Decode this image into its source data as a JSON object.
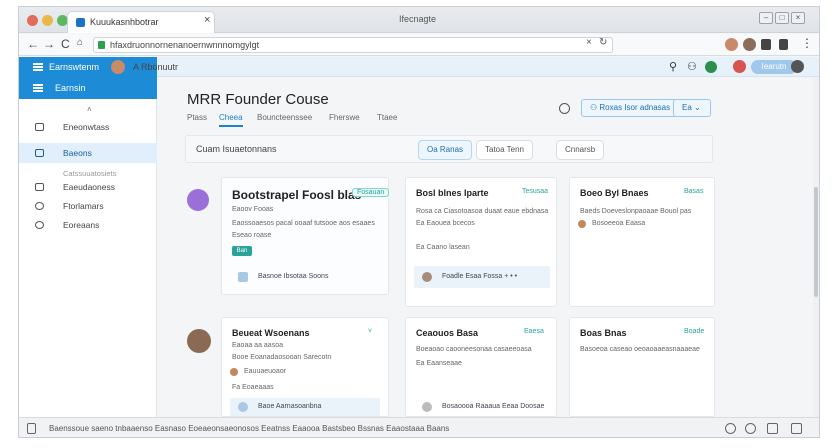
{
  "browser": {
    "tab_title": "Kuuukasnhbotrar",
    "window_title": "Ifecnagte",
    "url": "hfaxdruonnornenanoernwnnnomgylgt",
    "tab_close": "×"
  },
  "appbar": {
    "brand": "Earnswtenm",
    "user_name": "A  Rbonuutr",
    "pill_label": "Iearutn"
  },
  "sidebar": {
    "header": "Earnsin",
    "arrow": "˄",
    "items": [
      {
        "label": "Eneonwtass"
      },
      {
        "label": "Baeons"
      },
      {
        "label": "Eaeudaoness"
      },
      {
        "label": "Ftorlamars"
      },
      {
        "label": "Eoreaans"
      }
    ],
    "section_label": "Catssuuatosiets"
  },
  "page": {
    "title": "MRR Founder Couse",
    "tabs": [
      "Ptass",
      "Cheea",
      "Bouncteenssee",
      "Fherswe",
      "Ttaee"
    ],
    "action_button": "Roxas Isor adnasas",
    "dropdown": "Ea"
  },
  "filter": {
    "label": "Cuam  Isuaetonnans",
    "buttons": [
      "Oa  Ranas",
      "Tatoa Tenn",
      "Cnnarsb"
    ]
  },
  "cards": [
    {
      "title": "Bootstrapel Foosl blas",
      "badge": "Fosauan",
      "lines": [
        "Eaoov  Fooas",
        "Eaossoaesos pacal ooaaf tutsooe aos esaaes",
        "Eseao roase"
      ],
      "tag": "Ban",
      "footer": "Basnoe Ibsotaa Soons"
    },
    {
      "title": "Bosl blnes Iparte",
      "badge": "Tesusaa",
      "lines": [
        "Rosa ca Ciasotoasoa duaat eaue ebdnasa",
        "Ea  Eaouea bcecos",
        "Ea  Caano lasean"
      ],
      "footer": "Foadle Esaa Fossa   +  •  •"
    },
    {
      "title": "Boeo Byl Bnaes",
      "badge": "Basas",
      "lines": [
        "Baeds  Doeveslonpaoaae Bouol pas",
        "Bosoeeoa Eaasa"
      ]
    },
    {
      "title": "Beueat Wsoenans",
      "badge": "˅",
      "lines": [
        "Eaoaa  aa  aasoa",
        "Booe Eoanadaosooan Sarecotn",
        "Eauuaeuoaor",
        "Fa Eoaeaaas"
      ],
      "footer": "Baoe Aarnasoanbna"
    },
    {
      "title": "Ceaouos Basa",
      "badge": "Eaesa",
      "lines": [
        "Boeaoao caooneesonaa casaeeoasa",
        "Ea  Eaanseaae"
      ],
      "footer": "Bosaoooa Raaaua Eeaa Doosae"
    },
    {
      "title": "Boas Bnas",
      "badge": "Boade",
      "lines": [
        "Basoeoa caseao oeoaoaaeasnaaaeae"
      ]
    }
  ],
  "status": {
    "text": "Baenssoue  saeno tnbaaenso Easnaso         Eoeaeonsaeonosos  Eeatnss  Eaaooa  Bastsbeo  Bssnas  Eaaostaaa  Baans"
  },
  "colors": {
    "brand_blue": "#1e8bd6",
    "teal_accent": "#2aa39a",
    "purple_avatar": "#9b6fd8"
  }
}
